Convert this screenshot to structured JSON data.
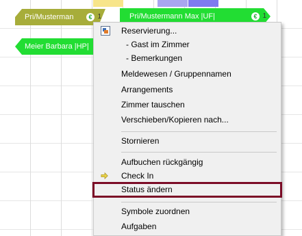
{
  "bookings": [
    {
      "label": "Pri/Musterman",
      "euro": "€",
      "number": "1"
    },
    {
      "label": "Pri/Mustermann Max |UF|",
      "euro": "€",
      "number": "1"
    },
    {
      "label": "Meier Barbara |HP|"
    }
  ],
  "menu": {
    "items": [
      {
        "label": "Reservierung..."
      },
      {
        "label": "- Gast im Zimmer"
      },
      {
        "label": "- Bemerkungen"
      },
      {
        "label": "Meldewesen / Gruppennamen"
      },
      {
        "label": "Arrangements"
      },
      {
        "label": "Zimmer tauschen"
      },
      {
        "label": "Verschieben/Kopieren nach..."
      },
      {
        "label": "Stornieren"
      },
      {
        "label": "Aufbuchen rückgängig"
      },
      {
        "label": "Check In"
      },
      {
        "label": "Status ändern"
      },
      {
        "label": "Symbole zuordnen"
      },
      {
        "label": "Aufgaben"
      }
    ],
    "highlight_color": "#7b0c26",
    "booking_color": "#22dd33",
    "selected_booking_color": "#a7ad3a",
    "icons": [
      "reservation-icon",
      "arrow-right-icon"
    ]
  }
}
